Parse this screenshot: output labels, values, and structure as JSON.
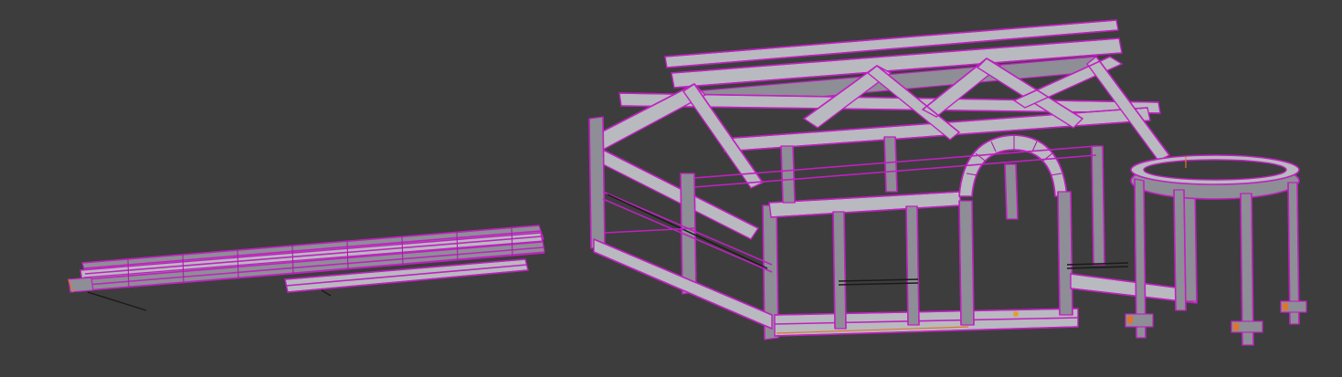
{
  "viewport": {
    "background": "#3d3d3d",
    "wire_color": "#c020c0",
    "face_color": "#b9b9c0",
    "highlight_color": "#e0752a"
  },
  "objects": [
    {
      "name": "timber-stack"
    },
    {
      "name": "pavilion-frame"
    },
    {
      "name": "circular-pergola"
    }
  ]
}
